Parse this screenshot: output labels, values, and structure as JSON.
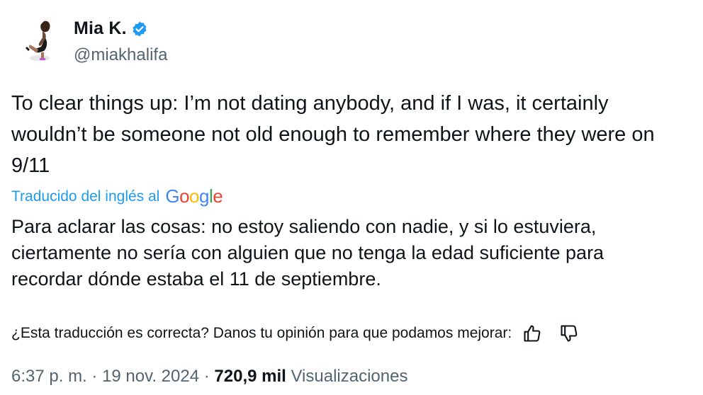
{
  "author": {
    "name": "Mia K.",
    "handle": "@miakhalifa",
    "verified_icon": "verified-badge-icon",
    "verified_color": "#1d9bf0"
  },
  "tweet": {
    "text": "To clear things up: I’m not dating anybody, and if I was, it certainly\nwouldn’t be someone not old enough to remember where they were on\n9/11"
  },
  "translation": {
    "label": "Traducido del inglés al",
    "provider_logo": [
      "G",
      "o",
      "o",
      "g",
      "l",
      "e"
    ],
    "text": "Para aclarar las cosas: no estoy saliendo con nadie, y si lo estuviera,\nciertamente no sería con alguien que no tenga la edad suficiente para\nrecordar dónde estaba el 11 de septiembre.",
    "feedback_prompt": "¿Esta traducción es correcta? Danos tu opinión para que podamos mejorar:",
    "thumbs_up_icon": "thumbs-up-icon",
    "thumbs_down_icon": "thumbs-down-icon"
  },
  "meta": {
    "time": "6:37 p. m.",
    "separator": " · ",
    "date": "19 nov. 2024",
    "views_count": "720,9 mil",
    "views_label": "Visualizaciones"
  },
  "colors": {
    "text_primary": "#0f1419",
    "text_secondary": "#536471",
    "link_blue": "#1d9bf0"
  }
}
